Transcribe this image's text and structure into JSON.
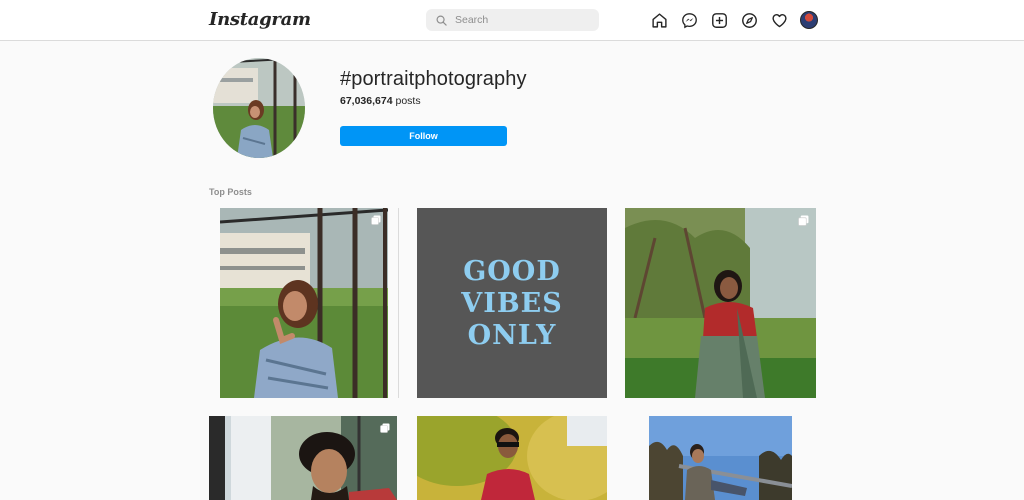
{
  "header": {
    "logo": "Instagram",
    "search_placeholder": "Search",
    "icons": [
      "home-icon",
      "messenger-icon",
      "new-post-icon",
      "explore-icon",
      "activity-heart-icon",
      "profile-avatar"
    ]
  },
  "hashtag": {
    "title": "#portraitphotography",
    "post_count": "67,036,674",
    "post_suffix": " posts",
    "follow_label": "Follow"
  },
  "section": {
    "label": "Top Posts"
  },
  "posts": [
    {
      "kind": "photo",
      "description_icon": "woman-by-fence"
    },
    {
      "kind": "text-graphic",
      "lines": [
        "GOOD",
        "VIBES",
        "ONLY"
      ]
    },
    {
      "kind": "photo",
      "multi": true,
      "description_icon": "woman-in-saree"
    },
    {
      "kind": "photo",
      "multi": true,
      "description_icon": "man-portrait"
    },
    {
      "kind": "photo",
      "description_icon": "boy-in-field"
    },
    {
      "kind": "photo",
      "description_icon": "man-on-bench"
    }
  ],
  "colors": {
    "accent": "#0095f6",
    "background": "#fafafa",
    "graphic_bg": "#555555",
    "graphic_text": "#8ecdf0"
  }
}
